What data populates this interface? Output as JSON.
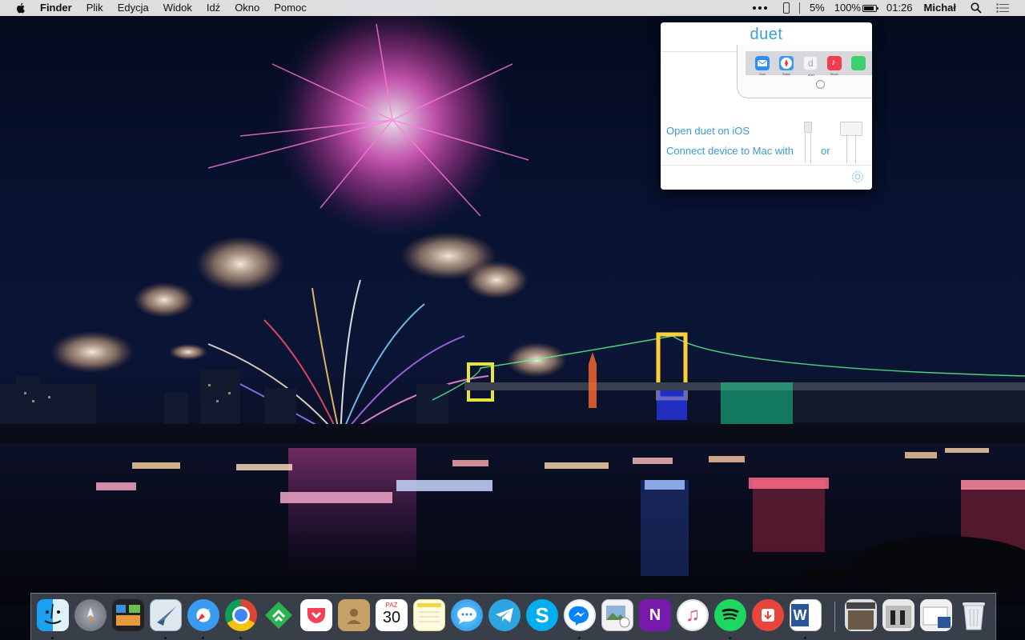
{
  "menubar": {
    "apple_icon": "apple-icon",
    "app_name": "Finder",
    "menus": [
      "Plik",
      "Edycja",
      "Widok",
      "Idź",
      "Okno",
      "Pomoc"
    ],
    "status": {
      "bluetooth_battery_percent": "5%",
      "battery_percent": "100%",
      "time": "01:26",
      "user": "Michał"
    }
  },
  "duet_popover": {
    "title": "duet",
    "open_text": "Open duet on iOS",
    "connect_text": "Connect device to Mac with",
    "or_text": "or",
    "ipad_apps": [
      {
        "icon": "mail-icon",
        "label": "Mail",
        "color": "#2f8ef6"
      },
      {
        "icon": "safari-icon",
        "label": "Safari",
        "color": "#3a9cf0"
      },
      {
        "icon": "duet-icon",
        "label": "duet",
        "color": "#f4f4f4"
      },
      {
        "icon": "music-icon",
        "label": "Music",
        "color": "#f23d4f"
      }
    ],
    "accent_color": "#3aa0d8"
  },
  "dock": {
    "apps": [
      {
        "name": "Finder",
        "icon": "finder-icon",
        "running": true
      },
      {
        "name": "Launchpad",
        "icon": "launchpad-icon",
        "running": false
      },
      {
        "name": "Mission Control",
        "icon": "mission-control-icon",
        "running": false
      },
      {
        "name": "Mail",
        "icon": "mail-icon",
        "running": true
      },
      {
        "name": "Safari",
        "icon": "safari-icon",
        "running": true
      },
      {
        "name": "Chrome",
        "icon": "chrome-icon",
        "running": true
      },
      {
        "name": "Feedly",
        "icon": "feedly-icon",
        "running": false
      },
      {
        "name": "Pocket",
        "icon": "pocket-icon",
        "running": false
      },
      {
        "name": "Contacts",
        "icon": "contacts-icon",
        "running": false
      },
      {
        "name": "Calendar",
        "icon": "calendar-icon",
        "running": false
      },
      {
        "name": "Notes",
        "icon": "notes-icon",
        "running": false
      },
      {
        "name": "Messages",
        "icon": "messages-icon",
        "running": false
      },
      {
        "name": "Telegram",
        "icon": "telegram-icon",
        "running": false
      },
      {
        "name": "Skype",
        "icon": "skype-icon",
        "running": false
      },
      {
        "name": "Messenger",
        "icon": "messenger-icon",
        "running": true
      },
      {
        "name": "Preview",
        "icon": "preview-icon",
        "running": false
      },
      {
        "name": "OneNote",
        "icon": "onenote-icon",
        "running": false
      },
      {
        "name": "iTunes",
        "icon": "itunes-icon",
        "running": false
      },
      {
        "name": "Spotify",
        "icon": "spotify-icon",
        "running": true
      },
      {
        "name": "Downie",
        "icon": "downie-icon",
        "running": false
      },
      {
        "name": "Word",
        "icon": "word-icon",
        "running": true
      }
    ],
    "calendar": {
      "month": "PAŹ",
      "day": "30"
    },
    "folders": [
      {
        "name": "Downloads stack",
        "icon": "downloads-stack-icon"
      },
      {
        "name": "Documents stack",
        "icon": "documents-stack-icon"
      },
      {
        "name": "Desktop stack",
        "icon": "desktop-stack-icon"
      }
    ],
    "trash": {
      "name": "Trash",
      "icon": "trash-icon"
    }
  }
}
